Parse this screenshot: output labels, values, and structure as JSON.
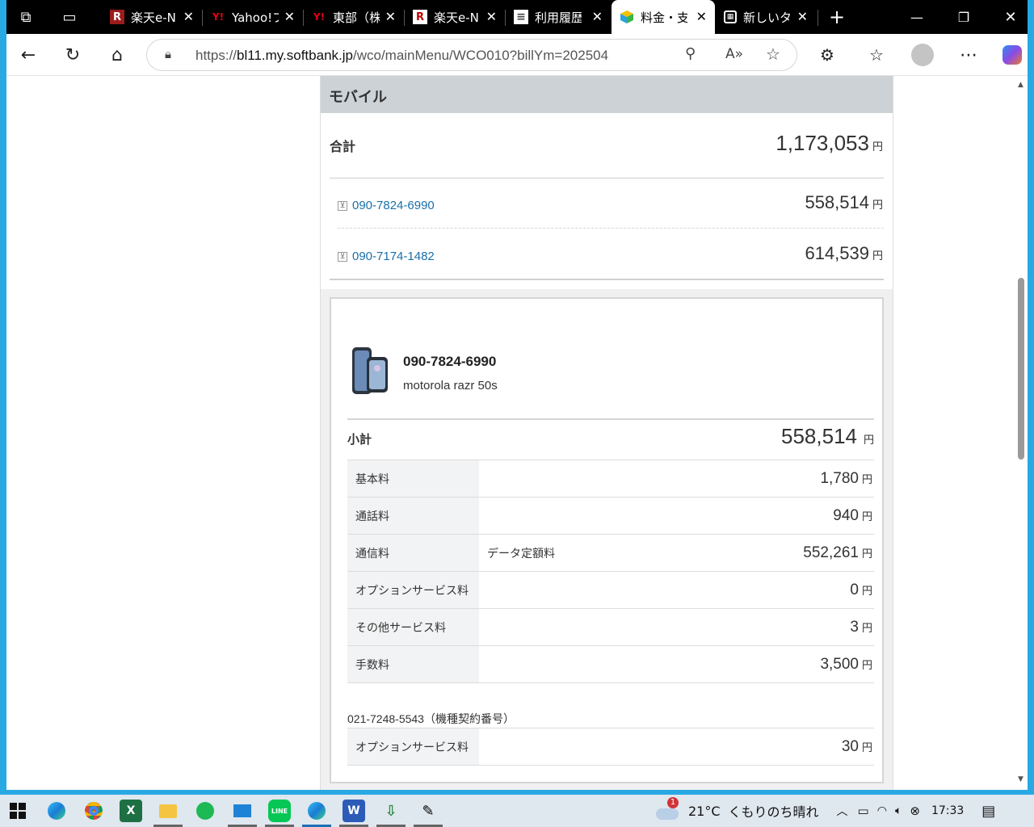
{
  "browser": {
    "tabs": [
      {
        "label": "楽天e-N",
        "icon": "rakuten-icon"
      },
      {
        "label": "Yahoo!フ",
        "icon": "yahoo-icon"
      },
      {
        "label": "東部（株",
        "icon": "yahoo-icon"
      },
      {
        "label": "楽天e-N",
        "icon": "rakuten-icon"
      },
      {
        "label": "利用履歴",
        "icon": "document-icon"
      },
      {
        "label": "料金・支",
        "icon": "softbank-cube-icon"
      },
      {
        "label": "新しいタ",
        "icon": "new-tab-icon"
      }
    ],
    "active_tab_index": 5,
    "url_prefix": "https://",
    "url_host": "bl11.my.softbank.jp",
    "url_path": "/wco/mainMenu/WCO010?billYm=202504"
  },
  "page": {
    "section_title": "モバイル",
    "total_label": "合計",
    "total_amount": "1,173,053",
    "yen": "円",
    "lines": [
      {
        "number": "090-7824-6990",
        "amount": "558,514"
      },
      {
        "number": "090-7174-1482",
        "amount": "614,539"
      }
    ],
    "device": {
      "number": "090-7824-6990",
      "model": "motorola razr 50s",
      "subtotal_label": "小計",
      "subtotal_amount": "558,514",
      "fees": [
        {
          "label": "基本料",
          "detail": "",
          "amount": "1,780"
        },
        {
          "label": "通話料",
          "detail": "",
          "amount": "940"
        },
        {
          "label": "通信料",
          "detail": "データ定額料",
          "amount": "552,261"
        },
        {
          "label": "オプションサービス料",
          "detail": "",
          "amount": "0"
        },
        {
          "label": "その他サービス料",
          "detail": "",
          "amount": "3"
        },
        {
          "label": "手数料",
          "detail": "",
          "amount": "3,500"
        }
      ],
      "contract_label": "021-7248-5543（機種契約番号）",
      "contract_fees": [
        {
          "label": "オプションサービス料",
          "detail": "",
          "amount": "30"
        }
      ]
    }
  },
  "taskbar": {
    "apps": [
      "edge-icon",
      "chrome-icon",
      "excel-icon",
      "file-explorer-icon",
      "spotify-icon",
      "remote-desktop-icon",
      "line-icon",
      "edge-icon",
      "word-icon",
      "download-icon",
      "paint-icon"
    ],
    "weather_badge": "1",
    "weather_temp": "21°C",
    "weather_text": "くもりのち晴れ",
    "time": "17:33"
  },
  "colors": {
    "accent": "#29a9e4",
    "link": "#1a6fa8",
    "section_head": "#cdd2d6"
  }
}
